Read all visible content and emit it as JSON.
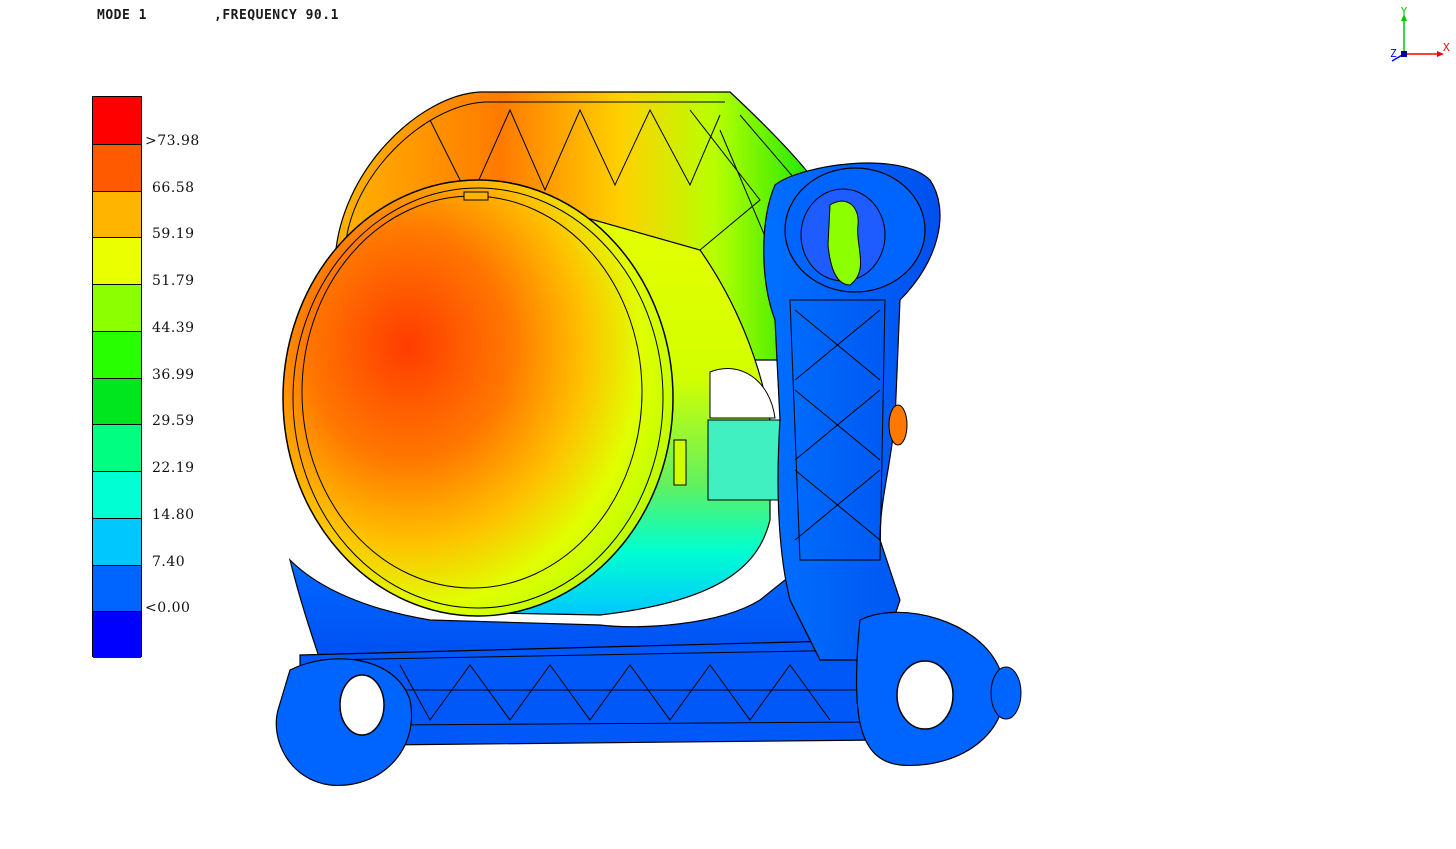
{
  "header": {
    "mode": "MODE 1",
    "frequency": ",FREQUENCY 90.1"
  },
  "legend": {
    "bands": [
      {
        "color": "#ff0000"
      },
      {
        "color": "#ff5a00"
      },
      {
        "color": "#ffb400"
      },
      {
        "color": "#eaff00"
      },
      {
        "color": "#8cff00"
      },
      {
        "color": "#28ff00"
      },
      {
        "color": "#00e61e"
      },
      {
        "color": "#00ff80"
      },
      {
        "color": "#00ffd2"
      },
      {
        "color": "#00c8ff"
      },
      {
        "color": "#0064ff"
      },
      {
        "color": "#0000ff"
      }
    ],
    "labels": [
      ">73.98",
      "66.58",
      "59.19",
      "51.79",
      "44.39",
      "36.99",
      "29.59",
      "22.19",
      "14.80",
      "7.40",
      "<0.00"
    ]
  },
  "triad": {
    "x_label": "X",
    "y_label": "Y",
    "z_label": "Z",
    "x_color": "#ff0000",
    "y_color": "#00c800",
    "z_color": "#0000ff"
  }
}
